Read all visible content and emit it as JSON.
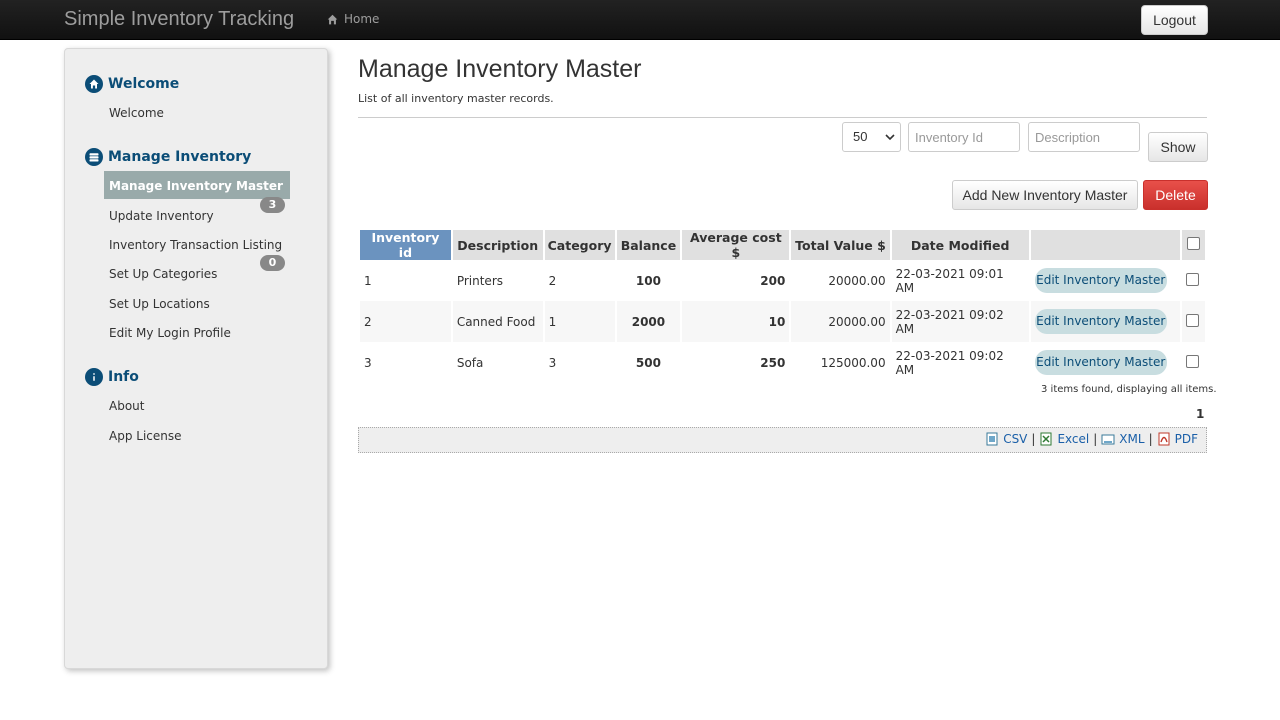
{
  "navbar": {
    "brand": "Simple Inventory Tracking",
    "home_label": "Home",
    "logout_label": "Logout"
  },
  "sidebar": {
    "sections": [
      {
        "heading": "Welcome",
        "icon": "home-icon",
        "items": [
          "Welcome"
        ]
      },
      {
        "heading": "Manage Inventory",
        "icon": "database-icon",
        "items": [
          "Manage Inventory Master",
          "Update Inventory",
          "Inventory Transaction Listing",
          "Set Up Categories",
          "Set Up Locations",
          "Edit My Login Profile"
        ]
      },
      {
        "heading": "Info",
        "icon": "info-icon",
        "items": [
          "About",
          "App License"
        ]
      }
    ],
    "active_item": "Manage Inventory Master",
    "badges": {
      "update_inventory": "3",
      "set_up_categories": "0"
    }
  },
  "main": {
    "title": "Manage Inventory Master",
    "subtitle": "List of all inventory master records."
  },
  "filters": {
    "page_size": "50",
    "inventory_id_placeholder": "Inventory Id",
    "description_placeholder": "Description",
    "show_label": "Show"
  },
  "actions": {
    "add_label": "Add New Inventory Master",
    "delete_label": "Delete"
  },
  "table": {
    "columns": [
      "Inventory id",
      "Description",
      "Category",
      "Balance",
      "Average cost $",
      "Total Value $",
      "Date Modified"
    ],
    "rows": [
      {
        "id": "1",
        "description": "Printers",
        "category": "2",
        "balance": "100",
        "avg_cost": "200",
        "total": "20000.00",
        "date": "22-03-2021 09:01 AM",
        "edit_label": "Edit Inventory Master"
      },
      {
        "id": "2",
        "description": "Canned Food",
        "category": "1",
        "balance": "2000",
        "avg_cost": "10",
        "total": "20000.00",
        "date": "22-03-2021 09:02 AM",
        "edit_label": "Edit Inventory Master"
      },
      {
        "id": "3",
        "description": "Sofa",
        "category": "3",
        "balance": "500",
        "avg_cost": "250",
        "total": "125000.00",
        "date": "22-03-2021 09:02 AM",
        "edit_label": "Edit Inventory Master"
      }
    ]
  },
  "footer": {
    "found_text": "3 items found, displaying all items.",
    "page": "1",
    "exports": [
      "CSV",
      "Excel",
      "XML",
      "PDF"
    ],
    "separator": "|"
  },
  "colors": {
    "accent": "#0b4d77",
    "sorted_header": "#6b93bf",
    "delete": "#d9534f",
    "balance": "#1a2c9e",
    "avg_cost": "#3a8a2b"
  }
}
